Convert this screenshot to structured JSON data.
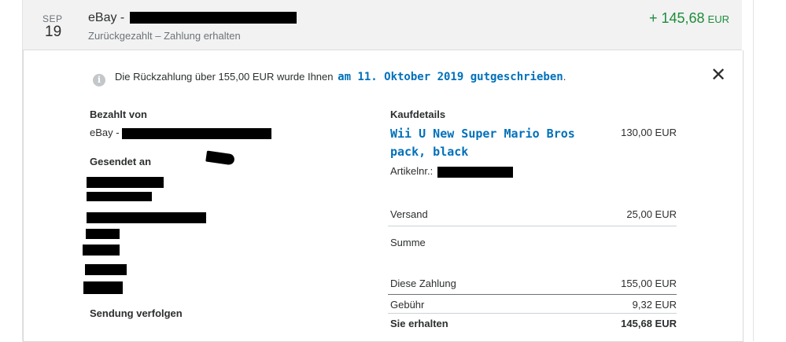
{
  "transaction": {
    "month": "SEP",
    "day": "19",
    "merchant_prefix": "eBay -",
    "subtitle": "Zurückgezahlt – Zahlung erhalten",
    "amount": "+ 145,68",
    "currency": "EUR"
  },
  "notice": {
    "icon": "info-icon",
    "text": "Die Rückzahlung über 155,00 EUR wurde Ihnen",
    "link": "am 11. Oktober 2019 gutgeschrieben",
    "suffix": "."
  },
  "left": {
    "paid_by_label": "Bezahlt von",
    "paid_by_prefix": "eBay -",
    "sent_to_label": "Gesendet an",
    "track_label": "Sendung verfolgen"
  },
  "purchase": {
    "heading": "Kaufdetails",
    "item_name": "Wii U New Super Mario Bros pack, black",
    "item_price": "130,00 EUR",
    "item_no_label": "Artikelnr.:",
    "shipping_label": "Versand",
    "shipping_value": "25,00 EUR",
    "sum_label": "Summe",
    "payment_label": "Diese Zahlung",
    "payment_value": "155,00 EUR",
    "fee_label": "Gebühr",
    "fee_value": "9,32 EUR",
    "received_label": "Sie erhalten",
    "received_value": "145,68 EUR"
  },
  "colors": {
    "amount_green": "#1e8c3c",
    "link_blue": "#0070ba",
    "header_bg": "#f2f2f2"
  }
}
